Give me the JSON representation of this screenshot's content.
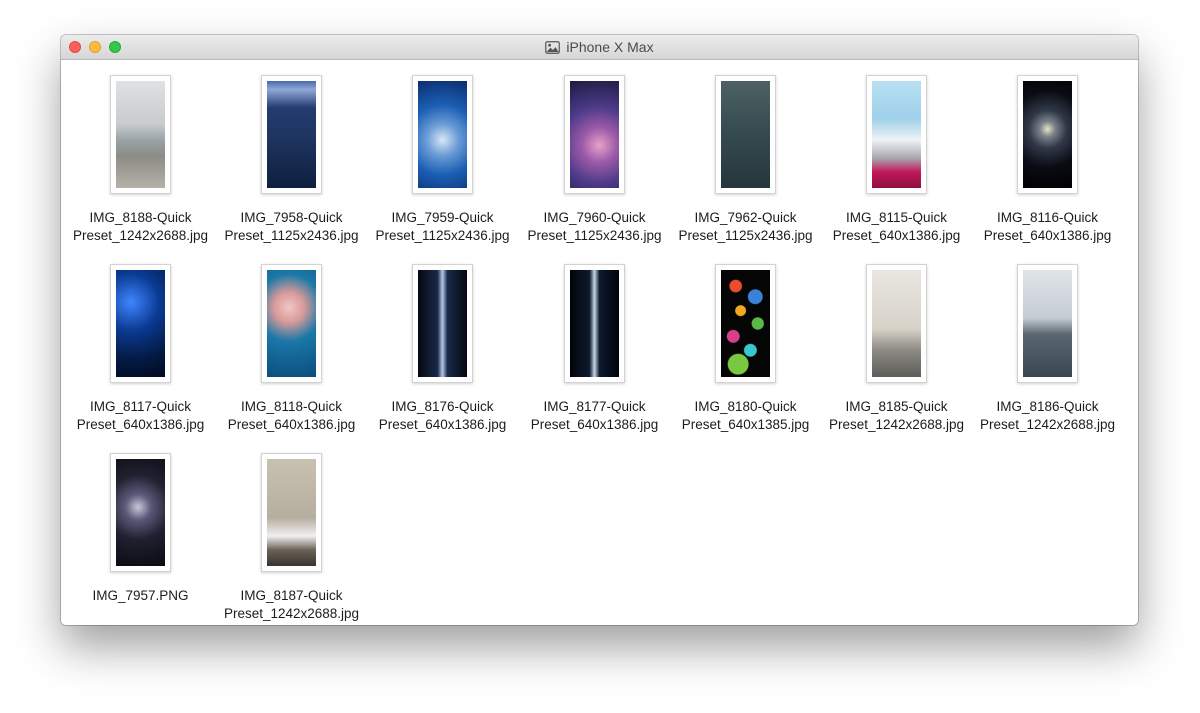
{
  "window": {
    "title": "iPhone X Max",
    "title_icon": "image-icon"
  },
  "files": [
    {
      "line1": "IMG_8188-Quick",
      "line2": "Preset_1242x2688.jpg"
    },
    {
      "line1": "IMG_7958-Quick",
      "line2": "Preset_1125x2436.jpg"
    },
    {
      "line1": "IMG_7959-Quick",
      "line2": "Preset_1125x2436.jpg"
    },
    {
      "line1": "IMG_7960-Quick",
      "line2": "Preset_1125x2436.jpg"
    },
    {
      "line1": "IMG_7962-Quick",
      "line2": "Preset_1125x2436.jpg"
    },
    {
      "line1": "IMG_8115-Quick",
      "line2": "Preset_640x1386.jpg"
    },
    {
      "line1": "IMG_8116-Quick",
      "line2": "Preset_640x1386.jpg"
    },
    {
      "line1": "IMG_8117-Quick",
      "line2": "Preset_640x1386.jpg"
    },
    {
      "line1": "IMG_8118-Quick",
      "line2": "Preset_640x1386.jpg"
    },
    {
      "line1": "IMG_8176-Quick",
      "line2": "Preset_640x1386.jpg"
    },
    {
      "line1": "IMG_8177-Quick",
      "line2": "Preset_640x1386.jpg"
    },
    {
      "line1": "IMG_8180-Quick",
      "line2": "Preset_640x1385.jpg"
    },
    {
      "line1": "IMG_8185-Quick",
      "line2": "Preset_1242x2688.jpg"
    },
    {
      "line1": "IMG_8186-Quick",
      "line2": "Preset_1242x2688.jpg"
    },
    {
      "line1": "IMG_7957.PNG",
      "line2": ""
    },
    {
      "line1": "IMG_8187-Quick",
      "line2": "Preset_1242x2688.jpg"
    }
  ]
}
